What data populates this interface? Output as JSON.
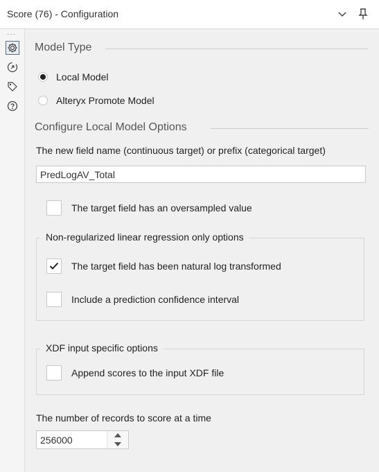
{
  "window": {
    "title": "Score (76) - Configuration",
    "collapse_icon": "chevron-down-icon",
    "pin_icon": "pin-icon"
  },
  "sidebar": {
    "overflow_label": "···",
    "items": [
      {
        "icon": "gear-icon",
        "active": true
      },
      {
        "icon": "annotation-icon",
        "active": false
      },
      {
        "icon": "tag-icon",
        "active": false
      },
      {
        "icon": "help-icon",
        "active": false
      }
    ]
  },
  "model_type": {
    "heading": "Model Type",
    "options": [
      {
        "label": "Local Model",
        "selected": true
      },
      {
        "label": "Alteryx Promote Model",
        "selected": false
      }
    ]
  },
  "local_options": {
    "heading": "Configure Local Model Options",
    "field_name_label": "The new field name (continuous target) or prefix (categorical target)",
    "field_name_value": "PredLogAV_Total",
    "oversampled_label": "The target field has an oversampled value",
    "oversampled_checked": false
  },
  "linear_group": {
    "title": "Non-regularized linear regression only options",
    "log_transformed_label": "The target field has been natural log transformed",
    "log_transformed_checked": true,
    "confidence_label": "Include a prediction confidence interval",
    "confidence_checked": false
  },
  "xdf_group": {
    "title": "XDF input specific options",
    "append_label": "Append scores to the input XDF file",
    "append_checked": false
  },
  "records": {
    "label": "The number of records to score at a time",
    "value": "256000"
  }
}
